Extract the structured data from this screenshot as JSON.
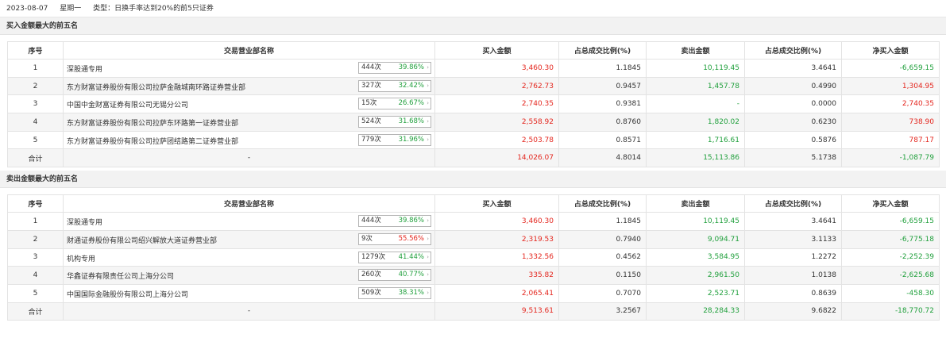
{
  "header": {
    "date": "2023-08-07",
    "weekday": "星期一",
    "type_label": "类型：",
    "type_value": "日换手率达到20%的前5只证券"
  },
  "columns": [
    "序号",
    "交易营业部名称",
    "买入金额",
    "占总成交比例(%)",
    "卖出金额",
    "占总成交比例(%)",
    "净买入金额"
  ],
  "buy_section": {
    "title": "买入金额最大的前五名",
    "rows": [
      {
        "no": "1",
        "name": "深股通专用",
        "count": "444次",
        "pct": "39.86%",
        "pct_color": "green",
        "buy": "3,460.30",
        "buy_ratio": "1.1845",
        "sell": "10,119.45",
        "sell_ratio": "3.4641",
        "net": "-6,659.15",
        "net_color": "green"
      },
      {
        "no": "2",
        "name": "东方财富证券股份有限公司拉萨金融城南环路证券营业部",
        "count": "327次",
        "pct": "32.42%",
        "pct_color": "green",
        "buy": "2,762.73",
        "buy_ratio": "0.9457",
        "sell": "1,457.78",
        "sell_ratio": "0.4990",
        "net": "1,304.95",
        "net_color": "red"
      },
      {
        "no": "3",
        "name": "中国中金财富证券有限公司无锡分公司",
        "count": "15次",
        "pct": "26.67%",
        "pct_color": "green",
        "buy": "2,740.35",
        "buy_ratio": "0.9381",
        "sell": "-",
        "sell_ratio": "0.0000",
        "net": "2,740.35",
        "net_color": "red"
      },
      {
        "no": "4",
        "name": "东方财富证券股份有限公司拉萨东环路第一证券营业部",
        "count": "524次",
        "pct": "31.68%",
        "pct_color": "green",
        "buy": "2,558.92",
        "buy_ratio": "0.8760",
        "sell": "1,820.02",
        "sell_ratio": "0.6230",
        "net": "738.90",
        "net_color": "red"
      },
      {
        "no": "5",
        "name": "东方财富证券股份有限公司拉萨团结路第二证券营业部",
        "count": "779次",
        "pct": "31.96%",
        "pct_color": "green",
        "buy": "2,503.78",
        "buy_ratio": "0.8571",
        "sell": "1,716.61",
        "sell_ratio": "0.5876",
        "net": "787.17",
        "net_color": "red"
      }
    ],
    "total": {
      "label": "合计",
      "name": "-",
      "buy": "14,026.07",
      "buy_ratio": "4.8014",
      "sell": "15,113.86",
      "sell_ratio": "5.1738",
      "net": "-1,087.79",
      "net_color": "green"
    }
  },
  "sell_section": {
    "title": "卖出金额最大的前五名",
    "rows": [
      {
        "no": "1",
        "name": "深股通专用",
        "count": "444次",
        "pct": "39.86%",
        "pct_color": "green",
        "buy": "3,460.30",
        "buy_ratio": "1.1845",
        "sell": "10,119.45",
        "sell_ratio": "3.4641",
        "net": "-6,659.15",
        "net_color": "green"
      },
      {
        "no": "2",
        "name": "财通证券股份有限公司绍兴解放大道证券营业部",
        "count": "9次",
        "pct": "55.56%",
        "pct_color": "red",
        "buy": "2,319.53",
        "buy_ratio": "0.7940",
        "sell": "9,094.71",
        "sell_ratio": "3.1133",
        "net": "-6,775.18",
        "net_color": "green"
      },
      {
        "no": "3",
        "name": "机构专用",
        "count": "1279次",
        "pct": "41.44%",
        "pct_color": "green",
        "buy": "1,332.56",
        "buy_ratio": "0.4562",
        "sell": "3,584.95",
        "sell_ratio": "1.2272",
        "net": "-2,252.39",
        "net_color": "green"
      },
      {
        "no": "4",
        "name": "华鑫证券有限责任公司上海分公司",
        "count": "260次",
        "pct": "40.77%",
        "pct_color": "green",
        "buy": "335.82",
        "buy_ratio": "0.1150",
        "sell": "2,961.50",
        "sell_ratio": "1.0138",
        "net": "-2,625.68",
        "net_color": "green"
      },
      {
        "no": "5",
        "name": "中国国际金融股份有限公司上海分公司",
        "count": "509次",
        "pct": "38.31%",
        "pct_color": "green",
        "buy": "2,065.41",
        "buy_ratio": "0.7070",
        "sell": "2,523.71",
        "sell_ratio": "0.8639",
        "net": "-458.30",
        "net_color": "green"
      }
    ],
    "total": {
      "label": "合计",
      "name": "-",
      "buy": "9,513.61",
      "buy_ratio": "3.2567",
      "sell": "28,284.33",
      "sell_ratio": "9.6822",
      "net": "-18,770.72",
      "net_color": "green"
    }
  },
  "icons": {
    "tag_arrow": "chevron-right-icon"
  }
}
